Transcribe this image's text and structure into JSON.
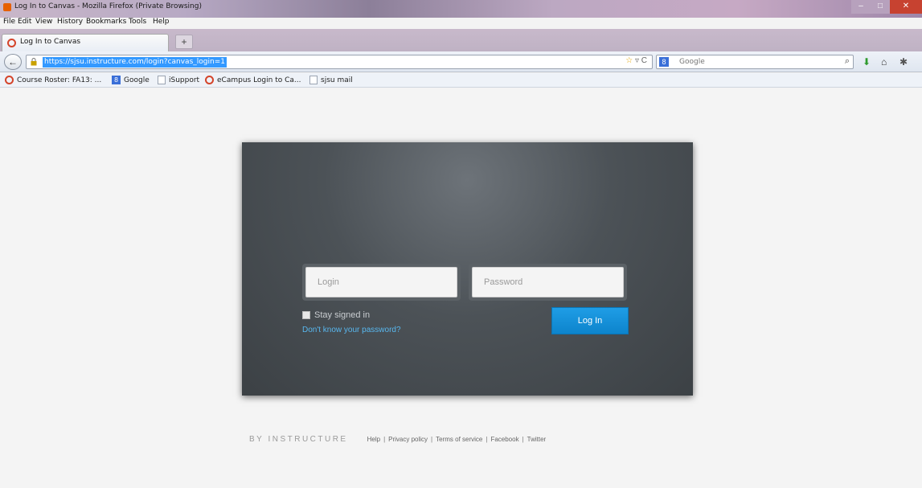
{
  "window": {
    "title": "Log In to Canvas - Mozilla Firefox (Private Browsing)",
    "buttons": {
      "minimize": "–",
      "maximize": "□",
      "close": "✕"
    }
  },
  "menu": [
    "File",
    "Edit",
    "View",
    "History",
    "Bookmarks",
    "Tools",
    "Help"
  ],
  "tabs": [
    {
      "label": "Log In to Canvas",
      "icon": "canvas-ring-icon"
    }
  ],
  "newtab_label": "+",
  "nav": {
    "back_label": "←",
    "url": "https://sjsu.instructure.com/login?canvas_login=1",
    "star": "☆",
    "dropdown": "▿",
    "reload": "C",
    "search_engine_badge": "8",
    "search_placeholder": "Google",
    "search_icon": "⌕",
    "download_icon": "⬇",
    "home_icon": "⌂",
    "extension_icon": "✱"
  },
  "bookmarks": [
    {
      "label": "Course Roster: FA13: ...",
      "icon": "ring"
    },
    {
      "label": "Google",
      "icon": "google"
    },
    {
      "label": "iSupport",
      "icon": "page"
    },
    {
      "label": "eCampus Login to Ca...",
      "icon": "ring"
    },
    {
      "label": "sjsu mail",
      "icon": "page"
    }
  ],
  "login": {
    "login_placeholder": "Login",
    "password_placeholder": "Password",
    "stay_signed_in": "Stay signed in",
    "forgot": "Don't know your password?",
    "submit": "Log In"
  },
  "footer": {
    "brand": "BY INSTRUCTURE",
    "links": [
      "Help",
      "Privacy policy",
      "Terms of service",
      "Facebook",
      "Twitter"
    ],
    "separator": "|"
  },
  "colors": {
    "accent": "#1197e0",
    "link": "#58b7ee",
    "panel": "#4c5257"
  }
}
